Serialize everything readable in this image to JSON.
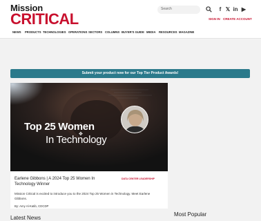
{
  "logo": {
    "line1": "Mission",
    "line2": "CRITICAL"
  },
  "header": {
    "search_placeholder": "Search",
    "social": [
      {
        "name": "facebook",
        "glyph": "f"
      },
      {
        "name": "x",
        "glyph": "𝕏"
      },
      {
        "name": "linkedin",
        "glyph": "in"
      },
      {
        "name": "youtube",
        "glyph": "▶"
      }
    ],
    "sign_in": "SIGN IN",
    "create_account": "CREATE ACCOUNT"
  },
  "nav": [
    "NEWS",
    "PRODUCTS",
    "TECHNOLOGIES",
    "OPERATIONS",
    "SECTORS",
    "COLUMNS",
    "BUYER'S GUIDE",
    "MEDIA",
    "RESOURCES",
    "MAGAZINE"
  ],
  "banner": {
    "text": "Submit your product now for our Top Tier Product Awards!"
  },
  "featured": {
    "hero_line1": "Top 25 Women",
    "hero_line2": "In Technology",
    "title": "Earlene Gibbons | A 2024 Top 25 Women In Technology Winner",
    "tag": "DATA CENTER LEADERSHIP",
    "description": "Mission Critical is excited to introduce you to the 2024 Top 25 Women in Technology. Meet Earlene Gibbons.",
    "byline": "By: Amy Al-Katib, CDCDP"
  },
  "sections": {
    "latest": "Latest News",
    "popular": "Most Popular"
  },
  "colors": {
    "brand_red": "#c8102e",
    "banner_teal": "#2b7a8b"
  }
}
